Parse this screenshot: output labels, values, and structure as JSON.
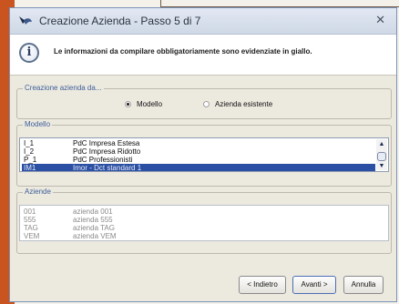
{
  "window": {
    "title": "Creazione Azienda - Passo 5 di 7",
    "close": "✕"
  },
  "info": {
    "icon": "info-icon",
    "text": "Le informazioni da compilare obbligatoriamente sono evidenziate in giallo."
  },
  "creation": {
    "legend": "Creazione azienda da...",
    "options": [
      {
        "label": "Modello",
        "selected": true
      },
      {
        "label": "Azienda esistente",
        "selected": false
      }
    ]
  },
  "modello": {
    "legend": "Modello",
    "rows": [
      {
        "code": "I_1",
        "desc": "PdC Impresa Estesa",
        "selected": false
      },
      {
        "code": "I_2",
        "desc": "PdC Impresa Ridotto",
        "selected": false
      },
      {
        "code": "P_1",
        "desc": "PdC Professionisti",
        "selected": false
      },
      {
        "code": "IM1",
        "desc": "Imor - Dct standard 1",
        "selected": true
      }
    ]
  },
  "aziende": {
    "legend": "Aziende",
    "rows": [
      {
        "code": "001",
        "desc": "azienda 001"
      },
      {
        "code": "555",
        "desc": "azienda 555"
      },
      {
        "code": "TAG",
        "desc": "azienda TAG"
      },
      {
        "code": "VEM",
        "desc": "azienda VEM"
      }
    ]
  },
  "buttons": {
    "back": "< Indietro",
    "next": "Avanti >",
    "cancel": "Annulla"
  },
  "colors": {
    "selection": "#2b4fa3",
    "legend": "#3e5f9a",
    "background_accent": "#c9541f"
  }
}
